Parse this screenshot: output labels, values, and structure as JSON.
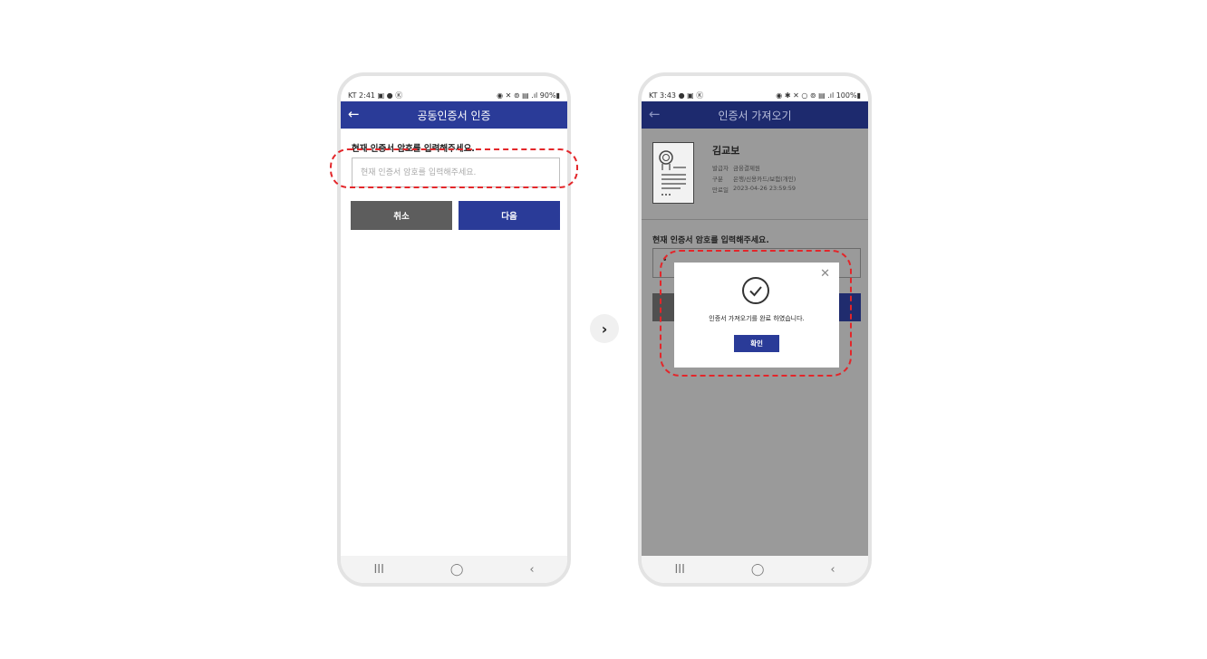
{
  "left_screen": {
    "status": {
      "left": "KT 2:41 ▣ ● Ⓚ",
      "right": "◉ ✕ ⊚ ▤ .ıl 90%▮"
    },
    "title": "공동인증서 인증",
    "back_icon": "←",
    "password_label": "현재 인증서 암호를 입력해주세요.",
    "password_placeholder": "현재 인증서 암호를 입력해주세요.",
    "cancel_label": "취소",
    "next_label": "다음",
    "nav": {
      "recent": "III",
      "home": "◯",
      "back": "‹"
    }
  },
  "right_screen": {
    "status": {
      "left": "KT 3:43 ● ▣ Ⓚ",
      "right": "◉ ✱ ✕ ○ ⊚ ▤ .ıl 100%▮"
    },
    "title": "인증서 가져오기",
    "back_icon": "←",
    "cert": {
      "name": "김교보",
      "issuer_key": "발급자",
      "issuer_value": "금융결제원",
      "type_key": "구분",
      "type_value": "은행/신용카드/보험(개인)",
      "expiry_key": "만료일",
      "expiry_value": "2023-04-26 23:59:59"
    },
    "password_label": "현재 인증서 암호를 입력해주세요.",
    "password_value": "•",
    "dialog": {
      "close_icon": "✕",
      "message": "인증서 가져오기를 완료 하였습니다.",
      "ok_label": "확인"
    },
    "nav": {
      "recent": "III",
      "home": "◯",
      "back": "‹"
    }
  },
  "next_arrow_icon": "›",
  "colors": {
    "primary": "#2a3b98",
    "highlight": "#e3262a",
    "cancel": "#5d5d5d"
  }
}
